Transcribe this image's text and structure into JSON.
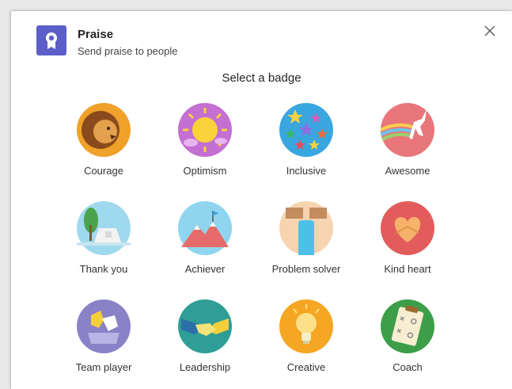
{
  "header": {
    "title": "Praise",
    "subtitle": "Send praise to people",
    "icon": "award-ribbon-icon",
    "accent": "#5b5fc7"
  },
  "section_title": "Select a badge",
  "badges": [
    {
      "label": "Courage",
      "icon": "lion-icon",
      "color": "#f0a12a"
    },
    {
      "label": "Optimism",
      "icon": "sun-icon",
      "color": "#c46fd2"
    },
    {
      "label": "Inclusive",
      "icon": "stars-icon",
      "color": "#3aa6e0"
    },
    {
      "label": "Awesome",
      "icon": "unicorn-icon",
      "color": "#e8767b"
    },
    {
      "label": "Thank you",
      "icon": "thank-you-card-icon",
      "color": "#9fd9ee"
    },
    {
      "label": "Achiever",
      "icon": "mountain-flag-icon",
      "color": "#8fd5ef"
    },
    {
      "label": "Problem solver",
      "icon": "fist-breaking-icon",
      "color": "#f6d4b0"
    },
    {
      "label": "Kind heart",
      "icon": "heart-hands-icon",
      "color": "#e25c5c"
    },
    {
      "label": "Team player",
      "icon": "puzzle-hands-icon",
      "color": "#8a82c6"
    },
    {
      "label": "Leadership",
      "icon": "handshake-icon",
      "color": "#2e9e96"
    },
    {
      "label": "Creative",
      "icon": "lightbulb-icon",
      "color": "#f5a623"
    },
    {
      "label": "Coach",
      "icon": "clipboard-play-icon",
      "color": "#3c9e48"
    }
  ]
}
